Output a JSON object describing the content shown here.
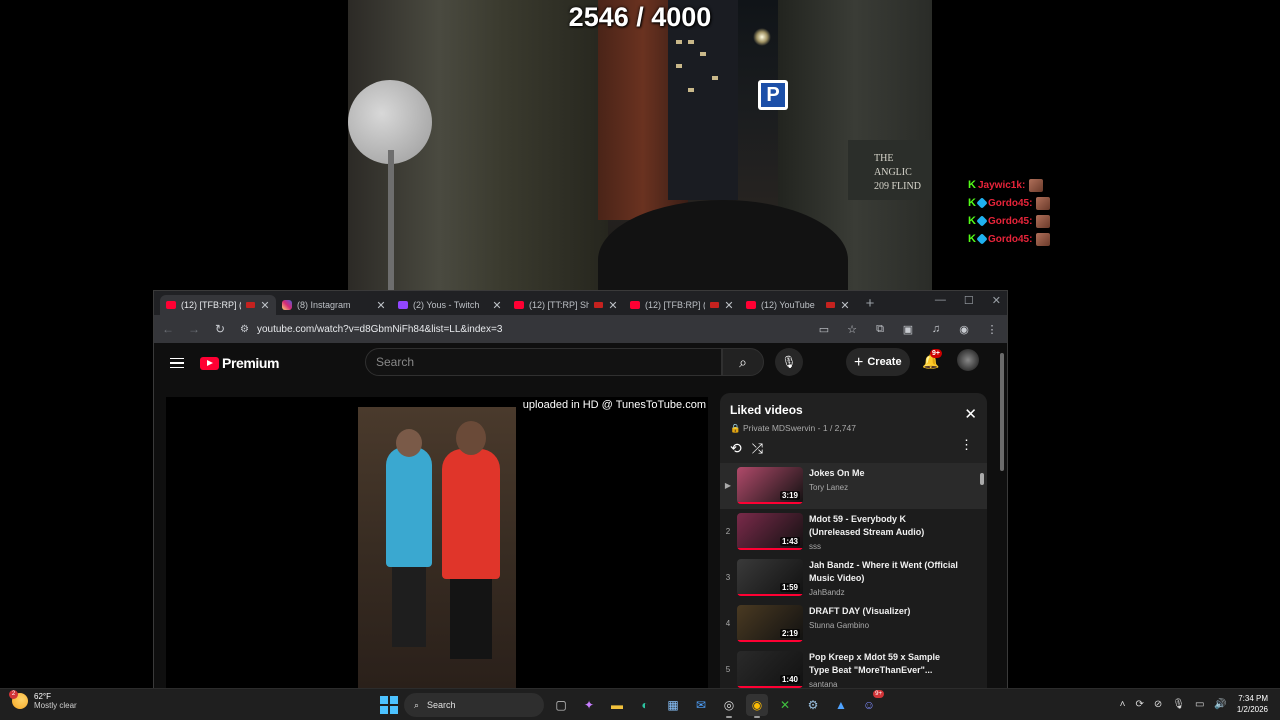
{
  "stream": {
    "goal_counter": "2546 / 4000",
    "sign_text_1": "THE ANGLIC",
    "sign_text_2": "209 FLIND",
    "parking_letter": "P"
  },
  "chat": [
    {
      "user": "Jaywic1k",
      "sep": ":"
    },
    {
      "user": "Gordo45",
      "sep": ":"
    },
    {
      "user": "Gordo45",
      "sep": ":"
    },
    {
      "user": "Gordo45",
      "sep": ":"
    }
  ],
  "browser": {
    "tabs": [
      {
        "title": "(12) [TFB:RP] (K",
        "icon": "youtube-icon",
        "active": true
      },
      {
        "title": "(8) Instagram",
        "icon": "instagram-icon",
        "active": false
      },
      {
        "title": "(2) Yous - Twitch",
        "icon": "twitch-icon",
        "active": false
      },
      {
        "title": "(12) [TT:RP] Sh",
        "icon": "youtube-icon",
        "active": false
      },
      {
        "title": "(12) [TFB:RP] (K",
        "icon": "youtube-icon",
        "active": false
      },
      {
        "title": "(12) YouTube",
        "icon": "youtube-icon",
        "active": false
      }
    ],
    "new_tab": "+",
    "url": "youtube.com/watch?v=d8GbmNiFh84&list=LL&index=3"
  },
  "youtube": {
    "logo_text": "Premium",
    "search_placeholder": "Search",
    "create_label": "Create",
    "notifications_count": "9+",
    "overlay_text": "uploaded in HD @ TunesToTube.com",
    "playlist": {
      "title": "Liked videos",
      "privacy": "Private",
      "owner": "MDSwervin",
      "position": "1 / 2,747",
      "items": [
        {
          "index": "▶",
          "title": "Jokes On Me",
          "channel": "Tory Lanez",
          "duration": "3:19",
          "thumb_color": "#b04a6a"
        },
        {
          "index": "2",
          "title": "Mdot 59 - Everybody K (Unreleased Stream Audio)",
          "channel": "sss",
          "duration": "1:43",
          "thumb_color": "#7a2a4a"
        },
        {
          "index": "3",
          "title": "Jah Bandz - Where it Went (Official Music Video)",
          "channel": "JahBandz",
          "duration": "1:59",
          "thumb_color": "#3a3a3a"
        },
        {
          "index": "4",
          "title": "DRAFT DAY (Visualizer)",
          "channel": "Stunna Gambino",
          "duration": "2:19",
          "thumb_color": "#4a3a22"
        },
        {
          "index": "5",
          "title": "Pop Kreep x Mdot 59 x Sample Type Beat \"MoreThanEver\"...",
          "channel": "santana",
          "duration": "1:40",
          "thumb_color": "#2a2a2a"
        }
      ]
    }
  },
  "taskbar": {
    "temperature": "62°F",
    "condition": "Mostly clear",
    "weather_badge": "2",
    "search_label": "Search",
    "discord_badge": "9+",
    "time": "7:34 PM",
    "date": "1/2/2026"
  }
}
